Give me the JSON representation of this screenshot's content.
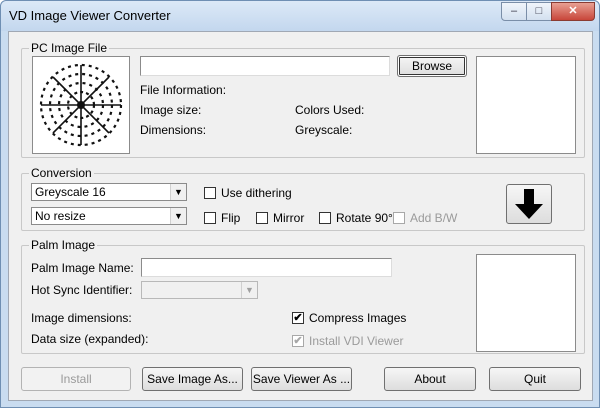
{
  "window": {
    "title": "VD Image Viewer Converter",
    "min_glyph": "–",
    "max_glyph": "□",
    "close_glyph": "✕"
  },
  "pc_image": {
    "group_label": "PC Image File",
    "file_path": "",
    "browse_label": "Browse",
    "file_info_label": "File Information:",
    "image_size_label": "Image size:",
    "dimensions_label": "Dimensions:",
    "colors_used_label": "Colors Used:",
    "greyscale_label": "Greyscale:"
  },
  "conversion": {
    "group_label": "Conversion",
    "color_mode": "Greyscale 16",
    "resize_mode": "No resize",
    "use_dithering_label": "Use dithering",
    "flip_label": "Flip",
    "mirror_label": "Mirror",
    "rotate_label": "Rotate 90°",
    "add_bw_label": "Add B/W",
    "convert_glyph": "🡇"
  },
  "palm_image": {
    "group_label": "Palm Image",
    "name_label": "Palm Image Name:",
    "name_value": "",
    "hotsync_label": "Hot Sync Identifier:",
    "hotsync_value": "",
    "image_dimensions_label": "Image dimensions:",
    "data_size_label": "Data size (expanded):",
    "compress_label": "Compress Images",
    "compress_checked": true,
    "install_viewer_label": "Install VDI Viewer",
    "install_viewer_checked": true
  },
  "buttons": {
    "install": "Install",
    "save_image": "Save Image As...",
    "save_viewer": "Save Viewer As ...",
    "about": "About",
    "quit": "Quit"
  },
  "icons": {
    "dropdown": "▼",
    "check": "✔"
  },
  "colors": {
    "title_bar": "#c9dcf0",
    "close_button": "#c8463a",
    "dialog_bg": "#f0f0f0"
  }
}
